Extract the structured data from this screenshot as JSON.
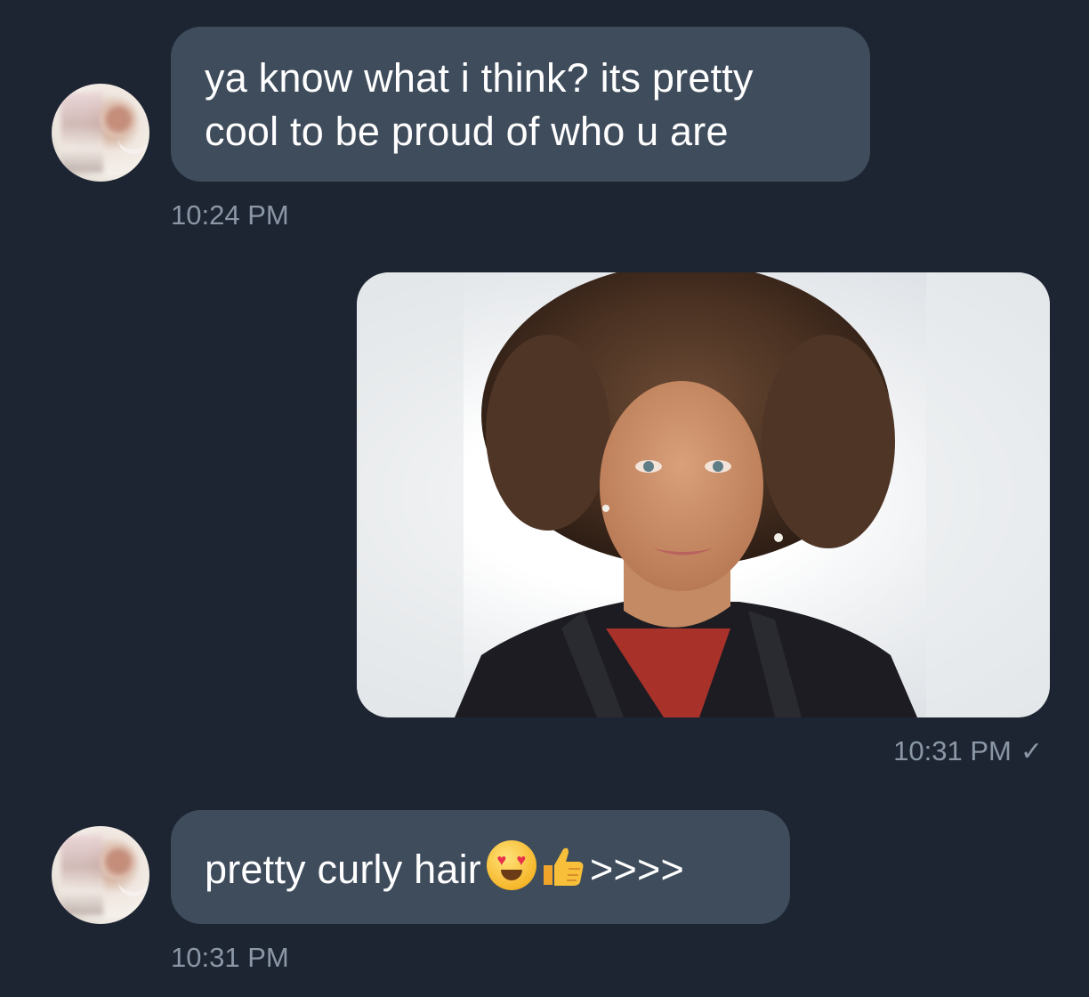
{
  "messages": [
    {
      "sender": "contact",
      "text_lines": [
        "ya know what i think? its pretty",
        "cool to be proud of who u are"
      ],
      "time": "10:24 PM"
    },
    {
      "sender": "me",
      "kind": "photo",
      "time": "10:31 PM",
      "status_icon": "checkmark-icon",
      "status_glyph": "✓"
    },
    {
      "sender": "contact",
      "text": "pretty curly hair",
      "emojis": [
        "heart-eyes-emoji",
        "thumbs-up-emoji"
      ],
      "suffix": ">>>>",
      "time": "10:31 PM"
    }
  ],
  "colors": {
    "background": "#1d2532",
    "incoming_bubble": "#3f4c5c",
    "timestamp": "#8b97a6"
  }
}
